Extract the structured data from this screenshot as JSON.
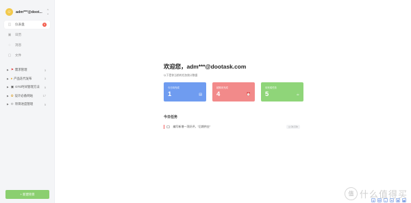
{
  "user": {
    "name": "adm***@doot..."
  },
  "nav": [
    {
      "label": "仪表盘",
      "badge": "6",
      "icon": "dashboard-icon"
    },
    {
      "label": "日历",
      "icon": "calendar-icon"
    },
    {
      "label": "消息",
      "icon": "message-icon"
    },
    {
      "label": "文件",
      "icon": "file-icon"
    }
  ],
  "projects": [
    {
      "label": "需求管理",
      "count": "3",
      "icon": "flag-icon"
    },
    {
      "label": "产品迭代发布",
      "count": "3",
      "icon": "pin-icon"
    },
    {
      "label": "GTD时间管理方法",
      "count": "5",
      "icon": "robot-icon"
    },
    {
      "label": "设计必备网站",
      "count": "17",
      "icon": "palette-icon"
    },
    {
      "label": "项目进度管理",
      "count": "5",
      "icon": "gear-icon"
    }
  ],
  "new_project_label": "+ 新建项目",
  "welcome_title": "欢迎您，adm***@dootask.com",
  "welcome_sub": "以下是你当前的任务统计数据",
  "cards": [
    {
      "label": "今日待完成",
      "value": "1",
      "color": "#6f9cf0"
    },
    {
      "label": "超期未完成",
      "value": "4",
      "color": "#f28a8a"
    },
    {
      "label": "待完成任务",
      "value": "5",
      "color": "#8fd579"
    }
  ],
  "today_title": "今日任务",
  "task": {
    "text": "编写新增一项好评，\"后期供应\"",
    "meta": "◷ 04:23h"
  },
  "watermark": {
    "circle": "值",
    "text": "什么值得买"
  },
  "tray": [
    "S",
    "中",
    "•",
    "⚘",
    "♜",
    "▦"
  ]
}
